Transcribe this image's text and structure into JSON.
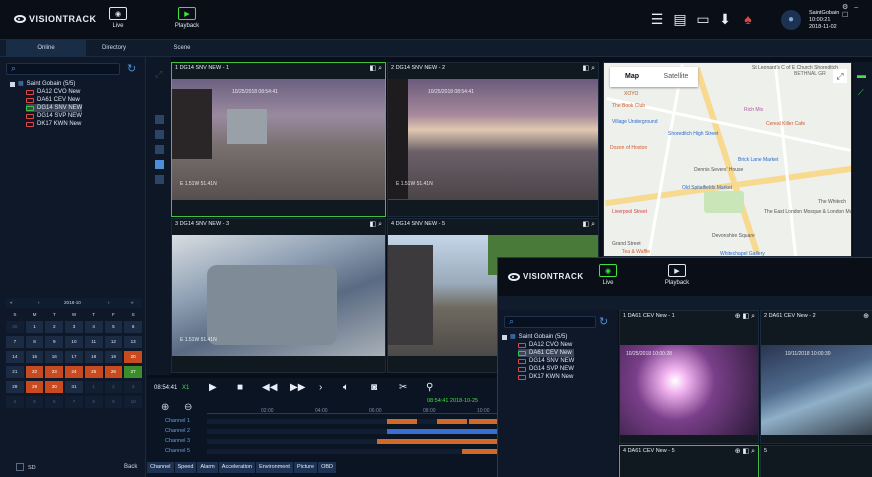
{
  "app": {
    "logo": "VISIONTRACK"
  },
  "modes": {
    "live": "Live",
    "playback": "Playback"
  },
  "user": {
    "name": "SaintGobain",
    "time": "10:00:21",
    "date": "2018-11-02"
  },
  "tabs": [
    "Online",
    "Directory",
    "Scene"
  ],
  "sidebar": {
    "root": "Saint Gobain (5/5)",
    "vehicles": [
      "DA12 CVO New",
      "DA61 CEV New",
      "DG14 SNV NEW",
      "DG14 SVP NEW",
      "DK17 KWN New"
    ],
    "selected_index": 2,
    "sd_label": "SD",
    "back_label": "Back"
  },
  "calendar": {
    "month": "2018-10",
    "weekdays": [
      "S",
      "M",
      "T",
      "W",
      "T",
      "F",
      "S"
    ],
    "rows": [
      [
        "30",
        "1",
        "2",
        "3",
        "4",
        "5",
        "6"
      ],
      [
        "7",
        "8",
        "9",
        "10",
        "11",
        "12",
        "13"
      ],
      [
        "14",
        "15",
        "16",
        "17",
        "18",
        "19",
        "20"
      ],
      [
        "21",
        "22",
        "23",
        "24",
        "25",
        "26",
        "27"
      ],
      [
        "28",
        "29",
        "30",
        "31",
        "1",
        "2",
        "3"
      ],
      [
        "4",
        "5",
        "6",
        "7",
        "8",
        "9",
        "10"
      ]
    ],
    "highlighted": [
      "20",
      "22",
      "23",
      "24",
      "25",
      "26",
      "29",
      "30"
    ],
    "today": "27"
  },
  "video": {
    "panels": [
      {
        "label": "1 DG14 SNV NEW - 1",
        "osd_top": "10/25/2018  08:54:41",
        "osd_bottom": "E 1.51W 51.41N"
      },
      {
        "label": "2 DG14 SNV NEW - 2",
        "osd_top": "10/25/2018  08:54:41",
        "osd_bottom": "E 1.51W 51.41N"
      },
      {
        "label": "3 DG14 SNV NEW - 3",
        "osd_top": "",
        "osd_bottom": "E 1.51W 51.41N"
      },
      {
        "label": "4 DG14 SNV NEW - 5",
        "osd_top": "",
        "osd_bottom": ""
      }
    ]
  },
  "map": {
    "tab_map": "Map",
    "tab_satellite": "Satellite",
    "labels": [
      "St Leonard's C of E Church Shoreditch",
      "BETHNAL GR",
      "XOYO",
      "The Book Club",
      "Rich Mix",
      "Village Underground",
      "Shoreditch High Street",
      "Cereal Killer Cafe",
      "Dozen of Hoxton",
      "Dennis Severs' House",
      "Brick Lane Market",
      "Old Spitalfields Market",
      "The Whitech",
      "Liverpool Street",
      "The East London Mosque & London Muslim Centre",
      "Grand Street",
      "Devonshire Square",
      "Whitechapel Gallery",
      "Tea & Waffle"
    ]
  },
  "playback": {
    "time": "08:54:41",
    "speed": "X1",
    "timestamp": "08:54:41 2018-10-25",
    "ticks": [
      "02:00",
      "04:00",
      "06:00",
      "08:00",
      "10:00"
    ],
    "channels": [
      "Channel 1",
      "Channel 2",
      "Channel 3",
      "Channel 5"
    ],
    "bottom_tabs": [
      "Channel",
      "Speed",
      "Alarm",
      "Acceleration",
      "Environment",
      "Picture",
      "OBD"
    ]
  },
  "overlay": {
    "logo": "VISIONTRACK",
    "live": "Live",
    "playback": "Playback",
    "root": "Saint Gobain (5/5)",
    "vehicles": [
      "DA12 CVO New",
      "DA61 CEV New",
      "DG14 SNV NEW",
      "DG14 SVP NEW",
      "DK17 KWN New"
    ],
    "selected_index": 1,
    "panels": [
      {
        "label": "1 DA61 CEV New - 1",
        "osd": "10/25/2018  10:00:28"
      },
      {
        "label": "2 DA61 CEV New - 2",
        "osd": "10/11/2018  10:00:30"
      },
      {
        "label": "4 DA61 CEV New - 5",
        "osd": ""
      },
      {
        "label": "5",
        "osd": ""
      }
    ]
  },
  "colors": {
    "accent_blue": "#4d8ed8",
    "active_green": "#3fe23f",
    "alert_red": "#e04646",
    "calendar_highlight": "#c94a1f"
  }
}
